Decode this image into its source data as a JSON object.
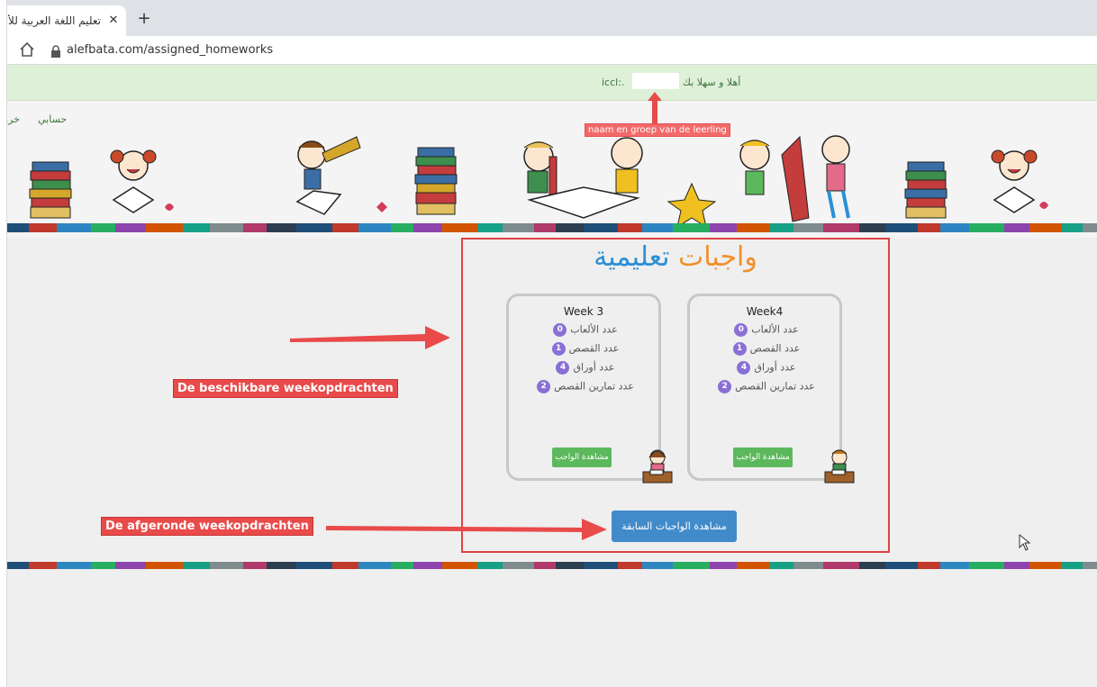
{
  "browser": {
    "tab_title": "تعليم اللغة العربية للأطفال",
    "tab_close": "✕",
    "new_tab": "+",
    "url": "alefbata.com/assigned_homeworks",
    "home_icon": "home-icon"
  },
  "welcome": {
    "greeting": "أهلا و سهلا بك يا",
    "group_prefix": "iccl:."
  },
  "nav": {
    "account": "حسابي",
    "logout": "خروج"
  },
  "annotations": {
    "name_group": "naam en groep van de leerling",
    "available": "De beschikbare weekopdrachten",
    "completed": "De afgeronde weekopdrachten"
  },
  "page": {
    "heading_part1": "واجبات",
    "heading_part2": "تعليمية",
    "heading_color1": "#f0902a",
    "heading_color2": "#2a8fd6",
    "previous_button": "مشاهدة الواجبات السابقة"
  },
  "cards": [
    {
      "title": "Week4",
      "games_label": "عدد الألعاب",
      "games": "0",
      "stories_label": "عدد القصص",
      "stories": "1",
      "sheets_label": "عدد أوراق",
      "sheets": "4",
      "exercises_label": "عدد تمارين القصص",
      "exercises": "2",
      "button": "مشاهدة الواجب"
    },
    {
      "title": "Week 3",
      "games_label": "عدد الألعاب",
      "games": "0",
      "stories_label": "عدد القصص",
      "stories": "1",
      "sheets_label": "عدد أوراق",
      "sheets": "4",
      "exercises_label": "عدد تمارين القصص",
      "exercises": "2",
      "button": "مشاهدة الواجب"
    }
  ],
  "colors": {
    "badge": "#8a6fd6",
    "green_button": "#5cb85c",
    "blue_button": "#428bca",
    "annotation_red": "#e94a4a",
    "welcome_bg": "#dff0d8"
  }
}
